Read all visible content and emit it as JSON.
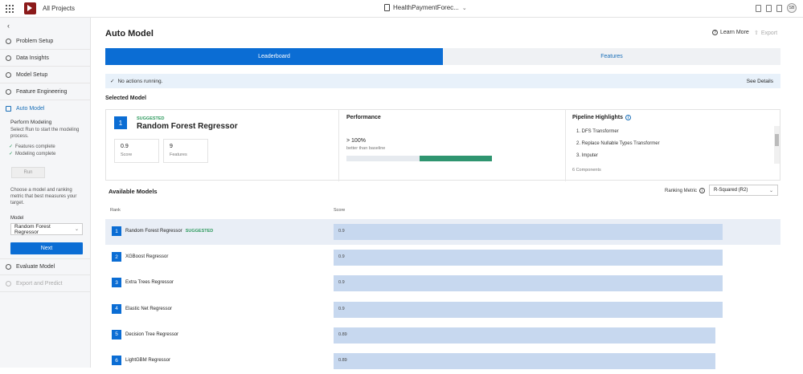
{
  "topbar": {
    "all_projects": "All Projects",
    "project_title": "HealthPaymentForec...",
    "avatar": "SB"
  },
  "sidebar": {
    "items": [
      {
        "label": "Problem Setup",
        "icon": "setup-icon"
      },
      {
        "label": "Data Insights",
        "icon": "insights-icon"
      },
      {
        "label": "Model Setup",
        "icon": "model-setup-icon"
      },
      {
        "label": "Feature Engineering",
        "icon": "feature-icon"
      },
      {
        "label": "Auto Model",
        "icon": "auto-model-icon"
      },
      {
        "label": "Evaluate Model",
        "icon": "evaluate-icon"
      },
      {
        "label": "Export and Predict",
        "icon": "export-icon"
      }
    ],
    "perform_title": "Perform Modeling",
    "perform_desc": "Select Run to start the modeling process.",
    "checks": [
      "Features complete",
      "Modeling complete"
    ],
    "run_label": "Run",
    "choose_text": "Choose a model and ranking metric that best measures your target.",
    "model_label": "Model",
    "model_value": "Random Forest Regressor",
    "next_label": "Next"
  },
  "main": {
    "title": "Auto Model",
    "learn_more": "Learn More",
    "export": "Export",
    "tabs": [
      {
        "label": "Leaderboard",
        "active": true
      },
      {
        "label": "Features",
        "active": false
      }
    ],
    "status": "No actions running.",
    "see_details": "See Details",
    "selected_model_label": "Selected Model",
    "selected": {
      "rank": "1",
      "suggested": "SUGGESTED",
      "name": "Random Forest Regressor",
      "score_value": "0.9",
      "score_label": "Score",
      "features_value": "9",
      "features_label": "Features",
      "performance_title": "Performance",
      "performance_value": "> 100%",
      "performance_sub": "better than baseline",
      "performance_fill_fraction": 0.5,
      "pipeline_title": "Pipeline Highlights",
      "pipeline_items": [
        "1. DFS Transformer",
        "2. Replace Nullable Types Transformer",
        "3. Imputer"
      ],
      "components": "6 Components"
    },
    "available_title": "Available Models",
    "ranking_metric_label": "Ranking Metric",
    "ranking_metric_value": "R-Squared (R2)",
    "col_rank": "Rank",
    "col_score": "Score",
    "rows": [
      {
        "rank": "1",
        "name": "Random Forest Regressor",
        "tag": "SUGGESTED",
        "score": "0.9",
        "value": 0.9
      },
      {
        "rank": "2",
        "name": "XGBoost Regressor",
        "tag": "",
        "score": "0.9",
        "value": 0.9
      },
      {
        "rank": "3",
        "name": "Extra Trees Regressor",
        "tag": "",
        "score": "0.9",
        "value": 0.9
      },
      {
        "rank": "4",
        "name": "Elastic Net Regressor",
        "tag": "",
        "score": "0.9",
        "value": 0.9
      },
      {
        "rank": "5",
        "name": "Decision Tree Regressor",
        "tag": "",
        "score": "0.89",
        "value": 0.89
      },
      {
        "rank": "6",
        "name": "LightGBM Regressor",
        "tag": "",
        "score": "0.89",
        "value": 0.89
      }
    ]
  },
  "colors": {
    "accent": "#0b6dd4",
    "success": "#2e9a5e",
    "bar": "#c7d8ef"
  }
}
